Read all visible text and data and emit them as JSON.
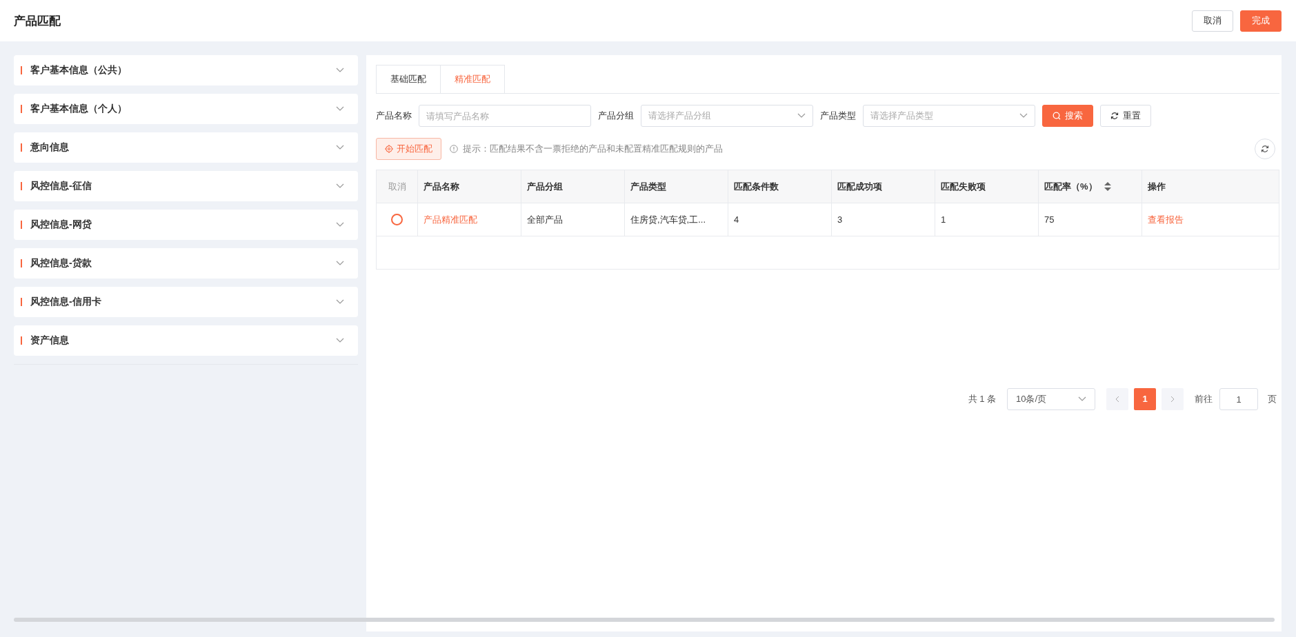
{
  "header": {
    "title": "产品匹配",
    "buttons": [
      {
        "label": "取消",
        "kind": "default"
      },
      {
        "label": "完成",
        "kind": "primary"
      }
    ]
  },
  "sections": [
    {
      "title": "客户基本信息（公共）",
      "expanded": false
    },
    {
      "title": "客户基本信息（个人）",
      "expanded": false
    },
    {
      "title": "意向信息",
      "expanded": false
    },
    {
      "title": "风控信息-征信",
      "expanded": false
    },
    {
      "title": "风控信息-网贷",
      "expanded": false
    },
    {
      "title": "风控信息-贷款",
      "expanded": false
    },
    {
      "title": "风控信息-信用卡",
      "expanded": false
    },
    {
      "title": "资产信息",
      "expanded": false
    }
  ],
  "tabs": [
    {
      "label": "基础匹配",
      "selected": false
    },
    {
      "label": "精准匹配",
      "selected": true
    }
  ],
  "filters": [
    {
      "label": "产品名称",
      "kind": "input",
      "placeholder": "请填写产品名称"
    },
    {
      "label": "产品分组",
      "kind": "select",
      "placeholder": "请选择产品分组"
    },
    {
      "label": "产品类型",
      "kind": "select",
      "placeholder": "请选择产品类型"
    }
  ],
  "actions": [
    {
      "label": "搜索",
      "kind": "primary"
    },
    {
      "label": "重置",
      "kind": "default"
    }
  ],
  "start_button": {
    "label": "开始匹配"
  },
  "hint": "提示：匹配结果不含一票拒绝的产品和未配置精准匹配规则的产品",
  "table": {
    "columns": [
      {
        "label": "取消",
        "kind": "select",
        "sortable": false
      },
      {
        "label": "产品名称",
        "kind": "link",
        "sortable": false
      },
      {
        "label": "产品分组",
        "kind": "text",
        "sortable": false
      },
      {
        "label": "产品类型",
        "kind": "text",
        "sortable": false
      },
      {
        "label": "匹配条件数",
        "kind": "text",
        "sortable": false
      },
      {
        "label": "匹配成功项",
        "kind": "text",
        "sortable": false
      },
      {
        "label": "匹配失败项",
        "kind": "text",
        "sortable": false
      },
      {
        "label": "匹配率（%）",
        "kind": "text",
        "sortable": true
      },
      {
        "label": "操作",
        "kind": "link",
        "sortable": false
      }
    ],
    "rows": [
      {
        "selected": false,
        "cells": [
          "",
          "产品精准匹配",
          "全部产品",
          "住房贷,汽车贷,工...",
          "4",
          "3",
          "1",
          "75",
          "查看报告"
        ]
      }
    ]
  },
  "pagination": {
    "total": "共 1 条",
    "page_size": "10条/页",
    "pages": [
      {
        "label": "1",
        "selected": true
      }
    ],
    "goto_label": "前往",
    "goto_value": "1",
    "goto_suffix": "页"
  }
}
